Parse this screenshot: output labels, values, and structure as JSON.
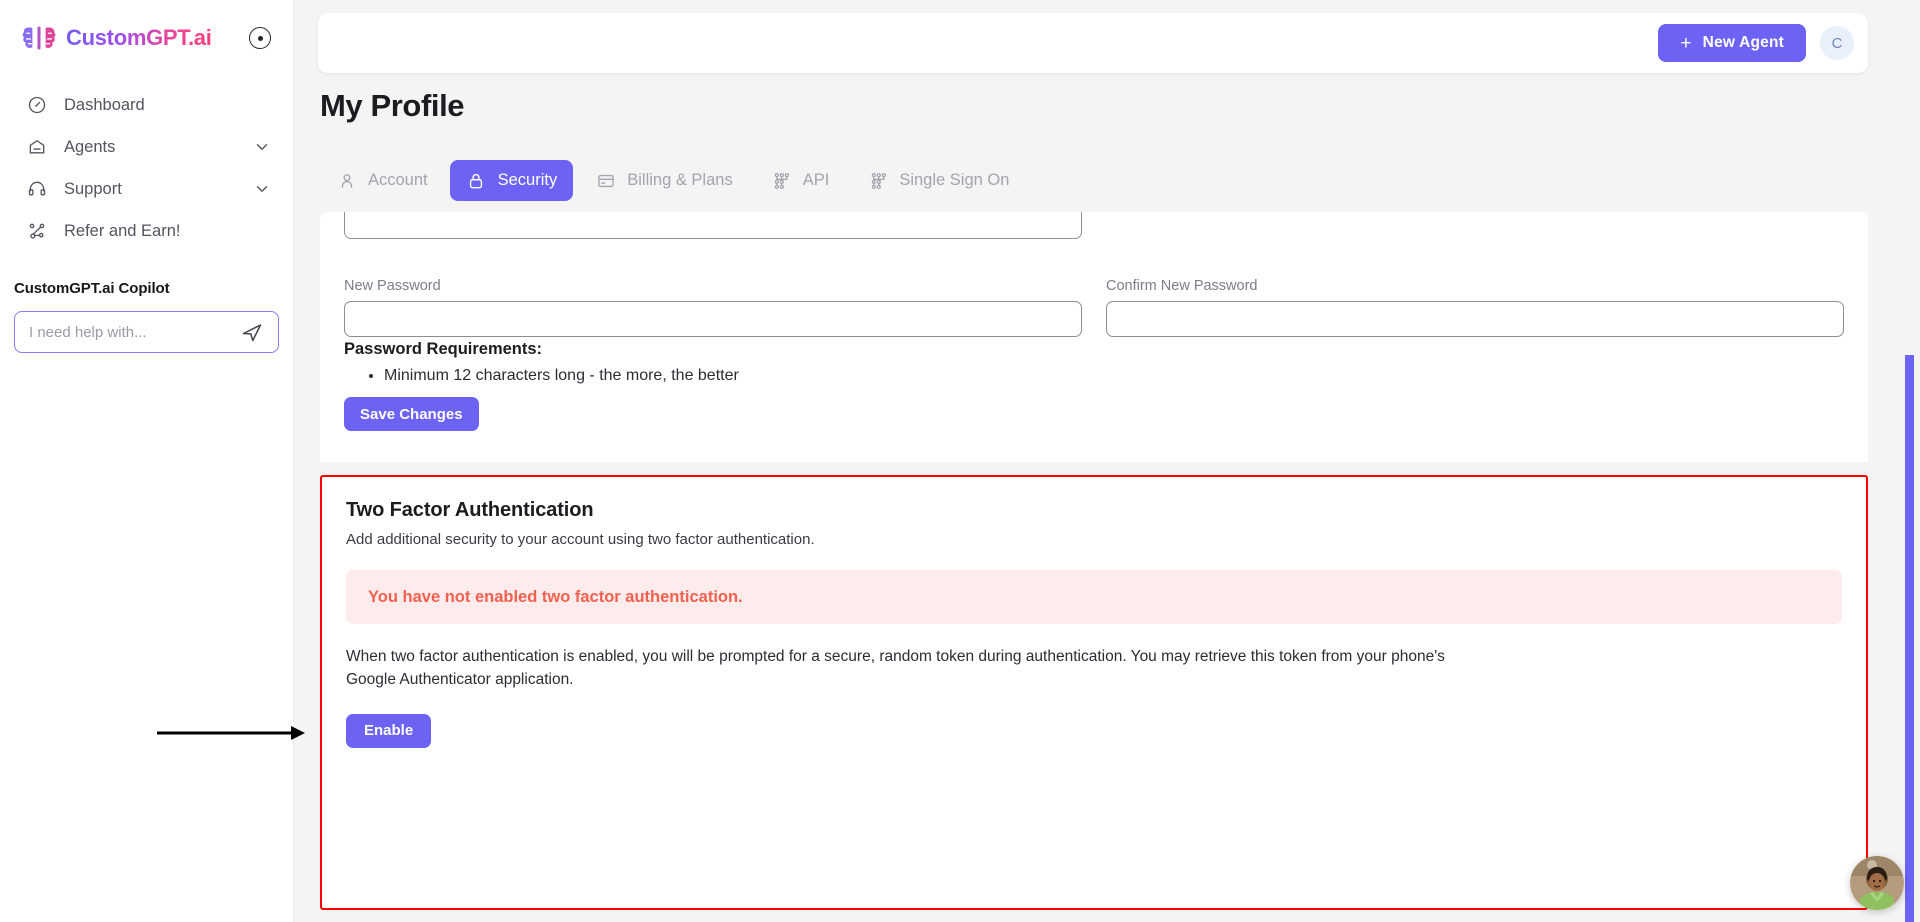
{
  "brand": {
    "name": "CustomGPT.ai",
    "logo_icon": "brain-logo-icon",
    "collapse_icon": "collapse-circle-icon"
  },
  "sidebar": {
    "items": [
      {
        "label": "Dashboard",
        "icon": "gauge-icon",
        "has_chevron": false
      },
      {
        "label": "Agents",
        "icon": "agent-envelope-icon",
        "has_chevron": true
      },
      {
        "label": "Support",
        "icon": "headset-icon",
        "has_chevron": true
      },
      {
        "label": "Refer and Earn!",
        "icon": "share-nodes-icon",
        "has_chevron": false
      }
    ],
    "copilot": {
      "title": "CustomGPT.ai Copilot",
      "placeholder": "I need help with...",
      "value": "",
      "send_icon": "paper-plane-icon"
    }
  },
  "topbar": {
    "new_agent_label": "New Agent",
    "new_agent_plus": "+",
    "avatar_initial": "C"
  },
  "page": {
    "title": "My Profile"
  },
  "tabs": [
    {
      "label": "Account",
      "icon": "user-icon",
      "active": false
    },
    {
      "label": "Security",
      "icon": "lock-icon",
      "active": true
    },
    {
      "label": "Billing & Plans",
      "icon": "credit-card-icon",
      "active": false
    },
    {
      "label": "API",
      "icon": "nodes-icon",
      "active": false
    },
    {
      "label": "Single Sign On",
      "icon": "nodes-icon",
      "active": false
    }
  ],
  "password_card": {
    "current_password": {
      "label": "",
      "value": ""
    },
    "new_password": {
      "label": "New Password",
      "value": ""
    },
    "confirm_password": {
      "label": "Confirm New Password",
      "value": ""
    },
    "requirements_title": "Password Requirements:",
    "requirements": [
      "Minimum 12 characters long - the more, the better"
    ],
    "save_label": "Save Changes"
  },
  "two_factor": {
    "title": "Two Factor Authentication",
    "subtitle": "Add additional security to your account using two factor authentication.",
    "alert": "You have not enabled two factor authentication.",
    "body": "When two factor authentication is enabled, you will be prompted for a secure, random token during authentication. You may retrieve this token from your phone's Google Authenticator application.",
    "enable_label": "Enable"
  },
  "colors": {
    "accent": "#6c63f5",
    "highlight_border": "#ff0000",
    "alert_text": "#f4604f",
    "alert_bg": "#fdeceb",
    "page_bg": "#f4f4f5"
  },
  "chat_widget": {
    "icon": "support-avatar-icon"
  },
  "annotation": {
    "arrow_icon": "pointer-arrow-icon"
  }
}
